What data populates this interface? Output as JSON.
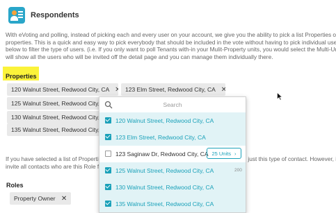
{
  "header": {
    "title": "Respondents"
  },
  "intro": {
    "lines": [
      "With eVoting and polling, instead of picking each and every user on your account, we give you the ability to pick a list Properties or",
      "properties. This is a quick and easy way to pick everybody that should be included in the vote without having to pick individual use",
      "below to filter the type of users. (i.e. If you only want to poll Tenants with-in your Mulit-Property units, you would select the Multi-Un",
      "will show all the users who will be invited off the detail page and you can manage them individually there."
    ]
  },
  "properties": {
    "label": "Properties",
    "selected": [
      "120 Walnut Street, Redwood City, CA",
      "123 Elm Street, Redwood City, CA",
      "125 Walnut Street, Redwood City, C",
      "130 Walnut Street, Redwood City, C",
      "135 Walnut Street, Redwood City, C"
    ]
  },
  "dropdown": {
    "search_placeholder": "Search",
    "options": [
      {
        "label": "120 Walnut Street, Redwood City, CA",
        "checked": true
      },
      {
        "label": "123 Elm Street, Redwood City, CA",
        "checked": true
      },
      {
        "label": "123 Saginaw Dr, Redwood City, CA",
        "checked": false,
        "badge": "25 Units",
        "badge_arrow": "›"
      },
      {
        "label": "125 Walnut Street, Redwood City, CA",
        "checked": true,
        "count": "200"
      },
      {
        "label": "130 Walnut Street, Redwood City, CA",
        "checked": true
      },
      {
        "label": "135 Walnut Street, Redwood City, CA",
        "checked": true
      }
    ]
  },
  "help": {
    "line1_left": "If you have selected a list of Propertie",
    "line1_right": "just this type of contact. However, if",
    "line2_left": "invite all contacts who are this Role fo"
  },
  "roles": {
    "label": "Roles",
    "selected": [
      "Property Owner"
    ]
  },
  "icons": {
    "remove": "✕"
  },
  "colors": {
    "accent": "#1aa1b9",
    "highlight": "#fbf33a",
    "selected_bg": "#e1f3f6"
  }
}
